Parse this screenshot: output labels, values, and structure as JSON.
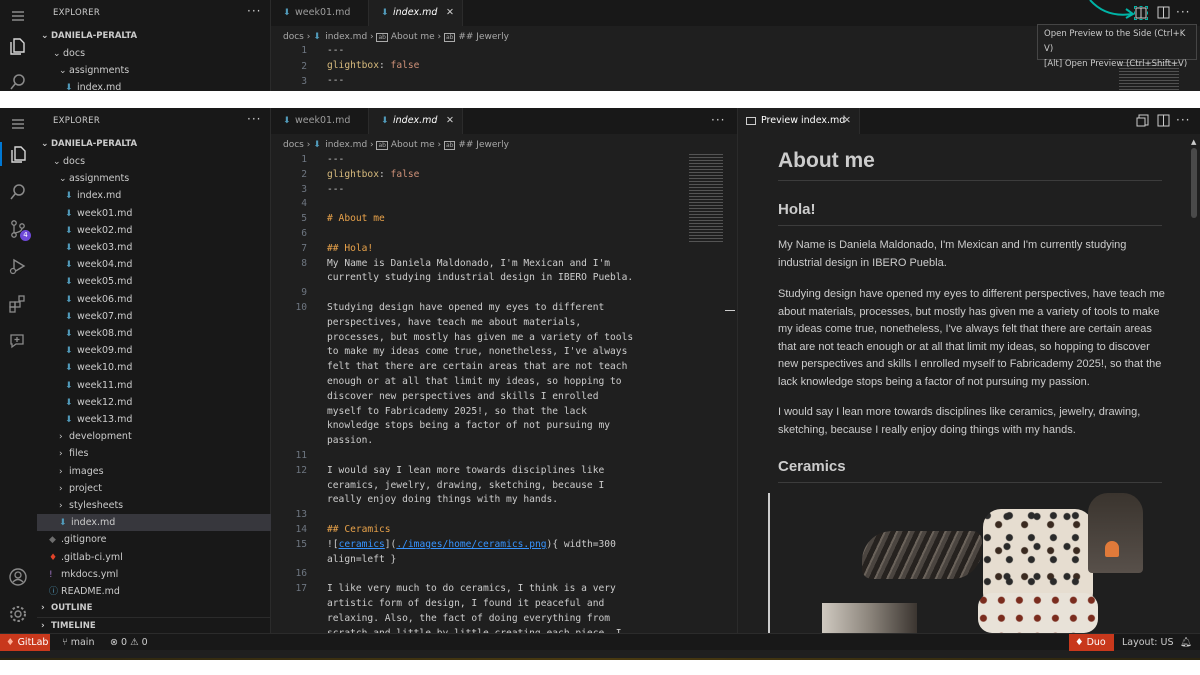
{
  "explorer_title": "EXPLORER",
  "workspace": "DANIELA-PERALTA",
  "top_panel": {
    "tabs": [
      {
        "label": "week01.md"
      },
      {
        "label": "index.md"
      }
    ],
    "breadcrumb": [
      "docs",
      "index.md",
      "About me",
      "## Jewerly"
    ],
    "tree": [
      "docs",
      "assignments",
      "index.md"
    ],
    "code": [
      {
        "ln": "1",
        "text": "---"
      },
      {
        "ln": "2",
        "key": "glightbox",
        "value": "false"
      },
      {
        "ln": "3",
        "text": "---"
      }
    ],
    "tooltip": [
      "Open Preview to the Side (Ctrl+K V)",
      "[Alt] Open Preview (Ctrl+Shift+V)"
    ]
  },
  "sidebar": {
    "items": [
      {
        "label": "docs",
        "kind": "folder-open"
      },
      {
        "label": "assignments",
        "kind": "folder-open"
      },
      {
        "label": "index.md",
        "kind": "md"
      },
      {
        "label": "week01.md",
        "kind": "md"
      },
      {
        "label": "week02.md",
        "kind": "md"
      },
      {
        "label": "week03.md",
        "kind": "md"
      },
      {
        "label": "week04.md",
        "kind": "md"
      },
      {
        "label": "week05.md",
        "kind": "md"
      },
      {
        "label": "week06.md",
        "kind": "md"
      },
      {
        "label": "week07.md",
        "kind": "md"
      },
      {
        "label": "week08.md",
        "kind": "md"
      },
      {
        "label": "week09.md",
        "kind": "md"
      },
      {
        "label": "week10.md",
        "kind": "md"
      },
      {
        "label": "week11.md",
        "kind": "md"
      },
      {
        "label": "week12.md",
        "kind": "md"
      },
      {
        "label": "week13.md",
        "kind": "md"
      },
      {
        "label": "development",
        "kind": "folder"
      },
      {
        "label": "files",
        "kind": "folder"
      },
      {
        "label": "images",
        "kind": "folder"
      },
      {
        "label": "project",
        "kind": "folder"
      },
      {
        "label": "stylesheets",
        "kind": "folder"
      },
      {
        "label": "index.md",
        "kind": "md"
      },
      {
        "label": ".gitignore",
        "kind": "file"
      },
      {
        "label": ".gitlab-ci.yml",
        "kind": "file"
      },
      {
        "label": "mkdocs.yml",
        "kind": "file"
      },
      {
        "label": "README.md",
        "kind": "file"
      }
    ],
    "outline": "OUTLINE",
    "timeline": "TIMELINE",
    "scm_badge": "4"
  },
  "editor": {
    "tabs": [
      {
        "label": "week01.md"
      },
      {
        "label": "index.md"
      }
    ],
    "breadcrumb": [
      "docs",
      "index.md",
      "About me",
      "## Jewerly"
    ],
    "lines": [
      {
        "ln": "1",
        "text": "---"
      },
      {
        "ln": "2",
        "key": "glightbox",
        "value": "false"
      },
      {
        "ln": "3",
        "text": "---"
      },
      {
        "ln": "4",
        "text": ""
      },
      {
        "ln": "5",
        "head": "# About me"
      },
      {
        "ln": "6",
        "text": ""
      },
      {
        "ln": "7",
        "head": "## Hola!"
      },
      {
        "ln": "8",
        "text": "My Name is Daniela Maldonado, I'm Mexican and I'm"
      },
      {
        "ln": "",
        "text": "currently studying industrial design in IBERO Puebla."
      },
      {
        "ln": "9",
        "text": ""
      },
      {
        "ln": "10",
        "text": "Studying design have opened my eyes to different"
      },
      {
        "ln": "",
        "text": "perspectives, have teach me about materials,"
      },
      {
        "ln": "",
        "text": "processes, but mostly has given me a variety of tools"
      },
      {
        "ln": "",
        "text": "to make my ideas come true, nonetheless, I've always"
      },
      {
        "ln": "",
        "text": "felt that there are certain areas that are not teach"
      },
      {
        "ln": "",
        "text": "enough or at all that limit my ideas, so hopping to"
      },
      {
        "ln": "",
        "text": "discover new perspectives and skills I enrolled"
      },
      {
        "ln": "",
        "text": "myself to Fabricademy 2025!, so that the lack"
      },
      {
        "ln": "",
        "text": "knowledge stops being a factor of not pursuing my"
      },
      {
        "ln": "",
        "text": "passion."
      },
      {
        "ln": "11",
        "text": ""
      },
      {
        "ln": "12",
        "text": "I would say I lean more towards disciplines like"
      },
      {
        "ln": "",
        "text": "ceramics, jewelry, drawing, sketching, because I"
      },
      {
        "ln": "",
        "text": "really enjoy doing things with my hands."
      },
      {
        "ln": "13",
        "text": ""
      },
      {
        "ln": "14",
        "head": "## Ceramics"
      },
      {
        "ln": "15",
        "img": true,
        "alt": "ceramics",
        "path": "./images/home/ceramics.png",
        "rest": "{ width=300"
      },
      {
        "ln": "",
        "text": "align=left }"
      },
      {
        "ln": "16",
        "text": ""
      },
      {
        "ln": "17",
        "text": "I like very much to do ceramics, I think is a very"
      },
      {
        "ln": "",
        "text": "artistic form of design, I found it peaceful and"
      },
      {
        "ln": "",
        "text": "relaxing. Also, the fact of doing everything from"
      },
      {
        "ln": "",
        "text": "scratch and little by little creating each piece, I"
      }
    ]
  },
  "preview": {
    "tab_label": "Preview index.md",
    "h1": "About me",
    "h2_hola": "Hola!",
    "p1": "My Name is Daniela Maldonado, I'm Mexican and I'm currently studying industrial design in IBERO Puebla.",
    "p2": "Studying design have opened my eyes to different perspectives, have teach me about materials, processes, but mostly has given me a variety of tools to make my ideas come true, nonetheless, I've always felt that there are certain areas that are not teach enough or at all that limit my ideas, so hopping to discover new perspectives and skills I enrolled myself to Fabricademy 2025!, so that the lack knowledge stops being a factor of not pursuing my passion.",
    "p3": "I would say I lean more towards disciplines like ceramics, jewelry, drawing, sketching, because I really enjoy doing things with my hands.",
    "h2_ceramics": "Ceramics"
  },
  "status": {
    "gitlab": "GitLab",
    "branch": "main",
    "errors": "0",
    "warnings": "0",
    "duo": "Duo",
    "layout": "Layout: US"
  },
  "colors": {
    "accent_blue": "#0078d4",
    "heading_orange": "#e8a24a",
    "link_blue": "#3794ff",
    "duo_red": "#c8381c",
    "gitlab_orange": "#e24329",
    "teal_annotation": "#00b4a6"
  }
}
